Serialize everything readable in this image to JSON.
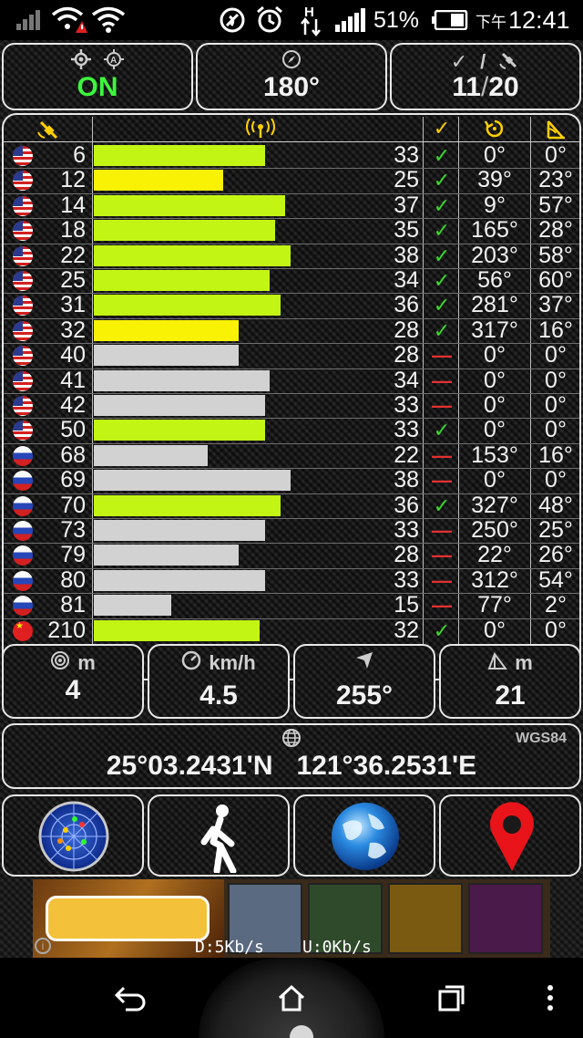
{
  "status_bar": {
    "battery_pct": "51%",
    "time_prefix": "下午",
    "time": "12:41",
    "icons": [
      "signal-weak-icon",
      "wifi-warning-icon",
      "wifi-icon",
      "nfc-icon",
      "alarm-icon",
      "h-data-icon",
      "cell-signal-icon",
      "battery-icon"
    ]
  },
  "top": {
    "gps_state": "ON",
    "heading": "180°",
    "sats_used": "11",
    "sats_slash": "/",
    "sats_total": "20"
  },
  "satellites": [
    {
      "prn": "6",
      "snr": "33",
      "snr_value": 33,
      "used": true,
      "azimuth": "0°",
      "elevation": "0°",
      "constellation": "us",
      "bar": "lime"
    },
    {
      "prn": "12",
      "snr": "25",
      "snr_value": 25,
      "used": true,
      "azimuth": "39°",
      "elevation": "23°",
      "constellation": "us",
      "bar": "yellow"
    },
    {
      "prn": "14",
      "snr": "37",
      "snr_value": 37,
      "used": true,
      "azimuth": "9°",
      "elevation": "57°",
      "constellation": "us",
      "bar": "lime"
    },
    {
      "prn": "18",
      "snr": "35",
      "snr_value": 35,
      "used": true,
      "azimuth": "165°",
      "elevation": "28°",
      "constellation": "us",
      "bar": "lime"
    },
    {
      "prn": "22",
      "snr": "38",
      "snr_value": 38,
      "used": true,
      "azimuth": "203°",
      "elevation": "58°",
      "constellation": "us",
      "bar": "lime"
    },
    {
      "prn": "25",
      "snr": "34",
      "snr_value": 34,
      "used": true,
      "azimuth": "56°",
      "elevation": "60°",
      "constellation": "us",
      "bar": "lime"
    },
    {
      "prn": "31",
      "snr": "36",
      "snr_value": 36,
      "used": true,
      "azimuth": "281°",
      "elevation": "37°",
      "constellation": "us",
      "bar": "lime"
    },
    {
      "prn": "32",
      "snr": "28",
      "snr_value": 28,
      "used": true,
      "azimuth": "317°",
      "elevation": "16°",
      "constellation": "us",
      "bar": "yellow"
    },
    {
      "prn": "40",
      "snr": "28",
      "snr_value": 28,
      "used": false,
      "azimuth": "0°",
      "elevation": "0°",
      "constellation": "us",
      "bar": "gray"
    },
    {
      "prn": "41",
      "snr": "34",
      "snr_value": 34,
      "used": false,
      "azimuth": "0°",
      "elevation": "0°",
      "constellation": "us",
      "bar": "gray"
    },
    {
      "prn": "42",
      "snr": "33",
      "snr_value": 33,
      "used": false,
      "azimuth": "0°",
      "elevation": "0°",
      "constellation": "us",
      "bar": "gray"
    },
    {
      "prn": "50",
      "snr": "33",
      "snr_value": 33,
      "used": true,
      "azimuth": "0°",
      "elevation": "0°",
      "constellation": "us",
      "bar": "lime"
    },
    {
      "prn": "68",
      "snr": "22",
      "snr_value": 22,
      "used": false,
      "azimuth": "153°",
      "elevation": "16°",
      "constellation": "ru",
      "bar": "gray"
    },
    {
      "prn": "69",
      "snr": "38",
      "snr_value": 38,
      "used": false,
      "azimuth": "0°",
      "elevation": "0°",
      "constellation": "ru",
      "bar": "gray"
    },
    {
      "prn": "70",
      "snr": "36",
      "snr_value": 36,
      "used": true,
      "azimuth": "327°",
      "elevation": "48°",
      "constellation": "ru",
      "bar": "lime"
    },
    {
      "prn": "73",
      "snr": "33",
      "snr_value": 33,
      "used": false,
      "azimuth": "250°",
      "elevation": "25°",
      "constellation": "ru",
      "bar": "gray"
    },
    {
      "prn": "79",
      "snr": "28",
      "snr_value": 28,
      "used": false,
      "azimuth": "22°",
      "elevation": "26°",
      "constellation": "ru",
      "bar": "gray"
    },
    {
      "prn": "80",
      "snr": "33",
      "snr_value": 33,
      "used": false,
      "azimuth": "312°",
      "elevation": "54°",
      "constellation": "ru",
      "bar": "gray"
    },
    {
      "prn": "81",
      "snr": "15",
      "snr_value": 15,
      "used": false,
      "azimuth": "77°",
      "elevation": "2°",
      "constellation": "ru",
      "bar": "gray"
    },
    {
      "prn": "210",
      "snr": "32",
      "snr_value": 32,
      "used": true,
      "azimuth": "0°",
      "elevation": "0°",
      "constellation": "cn",
      "bar": "lime"
    }
  ],
  "stats": {
    "accuracy_unit": "m",
    "accuracy": "4",
    "speed_unit": "km/h",
    "speed": "4.5",
    "bearing": "255°",
    "altitude_unit": "m",
    "altitude": "21"
  },
  "position": {
    "datum": "WGS84",
    "latitude": "25°03.2431'N",
    "longitude": "121°36.2531'E"
  },
  "actions": [
    "radar-icon",
    "walker-icon",
    "globe-icon",
    "map-pin-icon"
  ],
  "ad": {
    "download": "D:5Kb/s",
    "upload": "U:0Kb/s"
  },
  "colors": {
    "bar_good": "#c3f514",
    "bar_weak": "#f9f205",
    "bar_unused": "#d2d2d2",
    "used_check": "#3bd82e",
    "unused_dash": "#e23030",
    "gps_on": "#3df53d"
  }
}
